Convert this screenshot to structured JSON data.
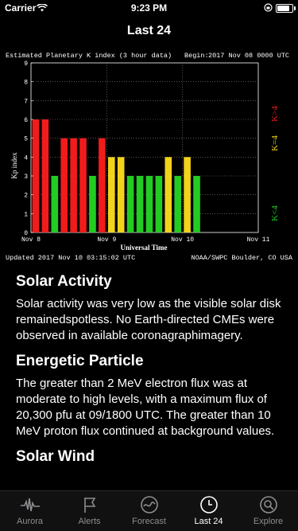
{
  "status_bar": {
    "carrier": "Carrier",
    "time": "9:23 PM"
  },
  "nav": {
    "title": "Last 24"
  },
  "chart_data": {
    "type": "bar",
    "title": "Estimated Planetary K index (3 hour data)",
    "begin_label": "Begin:",
    "begin_value": "2017 Nov 08 0000 UTC",
    "ylabel": "Kp index",
    "xlabel": "Universal Time",
    "ylim": [
      0,
      9
    ],
    "yticks": [
      "0",
      "1",
      "2",
      "3",
      "4",
      "5",
      "6",
      "7",
      "8",
      "9"
    ],
    "xticks": [
      "Nov 8",
      "Nov 9",
      "Nov 10",
      "Nov 11"
    ],
    "values": [
      6,
      6,
      3,
      5,
      5,
      5,
      3,
      5,
      4,
      4,
      3,
      3,
      3,
      3,
      4,
      3,
      4,
      3
    ],
    "colors": {
      "quiet": "#22cc22",
      "moderate": "#f2d31b",
      "storm": "#f21b1b"
    },
    "right_labels": [
      "K<4",
      "K=4",
      "K>4"
    ],
    "updated": "Updated 2017 Nov 10 03:15:02 UTC",
    "source": "NOAA/SWPC Boulder, CO USA",
    "grid": true
  },
  "sections": [
    {
      "title": "Solar Activity",
      "body": "Solar activity was very low as the visible solar disk remainedspotless. No Earth-directed CMEs were observed in available coronagraphimagery."
    },
    {
      "title": "Energetic Particle",
      "body": "The greater than 2 MeV electron flux was at moderate to high levels, with a maximum flux of 20,300 pfu at 09/1800 UTC. The greater than 10 MeV proton flux continued at background values."
    },
    {
      "title": "Solar Wind",
      "body": ""
    }
  ],
  "tabs": [
    {
      "label": "Aurora",
      "icon": "aurora-icon"
    },
    {
      "label": "Alerts",
      "icon": "flag-icon"
    },
    {
      "label": "Forecast",
      "icon": "forecast-icon"
    },
    {
      "label": "Last 24",
      "icon": "clock-icon",
      "active": true
    },
    {
      "label": "Explore",
      "icon": "explore-icon"
    }
  ]
}
